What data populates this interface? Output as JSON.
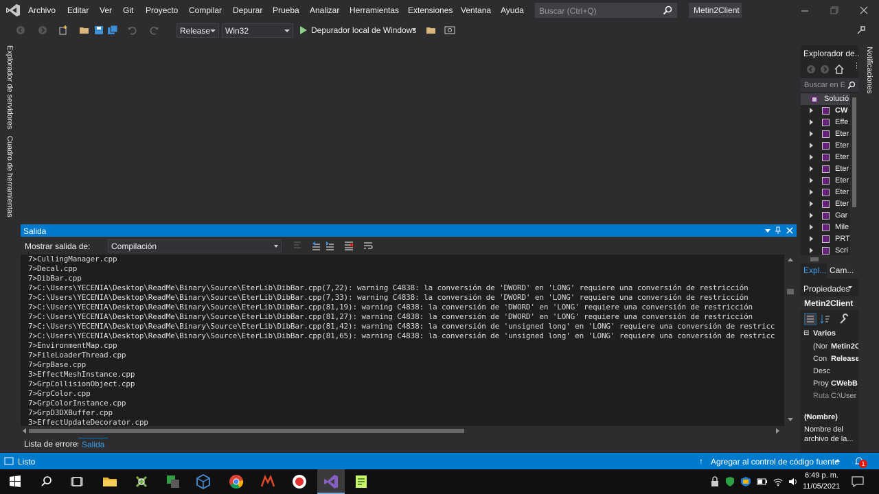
{
  "menubar": {
    "items": [
      "Archivo",
      "Editar",
      "Ver",
      "Git",
      "Proyecto",
      "Compilar",
      "Depurar",
      "Prueba",
      "Analizar",
      "Herramientas",
      "Extensiones",
      "Ventana",
      "Ayuda"
    ],
    "search_placeholder": "Buscar (Ctrl+Q)",
    "solution_name": "Metin2Client"
  },
  "toolbar": {
    "configuration": "Release",
    "platform": "Win32",
    "run_label": "Depurador local de Windows"
  },
  "left_tabs": [
    "Explorador de servidores",
    "Cuadro de herramientas"
  ],
  "right_tab": "Notificaciones",
  "output": {
    "title": "Salida",
    "show_label": "Mostrar salida de:",
    "source": "Compilación",
    "lines": [
      "7>CullingManager.cpp",
      "7>Decal.cpp",
      "7>DibBar.cpp",
      "7>C:\\Users\\YECENIA\\Desktop\\ReadMe\\Binary\\Source\\EterLib\\DibBar.cpp(7,22): warning C4838: la conversión de 'DWORD' en 'LONG' requiere una conversión de restricción",
      "7>C:\\Users\\YECENIA\\Desktop\\ReadMe\\Binary\\Source\\EterLib\\DibBar.cpp(7,33): warning C4838: la conversión de 'DWORD' en 'LONG' requiere una conversión de restricción",
      "7>C:\\Users\\YECENIA\\Desktop\\ReadMe\\Binary\\Source\\EterLib\\DibBar.cpp(81,19): warning C4838: la conversión de 'DWORD' en 'LONG' requiere una conversión de restricción",
      "7>C:\\Users\\YECENIA\\Desktop\\ReadMe\\Binary\\Source\\EterLib\\DibBar.cpp(81,27): warning C4838: la conversión de 'DWORD' en 'LONG' requiere una conversión de restricción",
      "7>C:\\Users\\YECENIA\\Desktop\\ReadMe\\Binary\\Source\\EterLib\\DibBar.cpp(81,42): warning C4838: la conversión de 'unsigned long' en 'LONG' requiere una conversión de restricc",
      "7>C:\\Users\\YECENIA\\Desktop\\ReadMe\\Binary\\Source\\EterLib\\DibBar.cpp(81,65): warning C4838: la conversión de 'unsigned long' en 'LONG' requiere una conversión de restricc",
      "7>EnvironmentMap.cpp",
      "7>FileLoaderThread.cpp",
      "7>GrpBase.cpp",
      "3>EffectMeshInstance.cpp",
      "7>GrpCollisionObject.cpp",
      "7>GrpColor.cpp",
      "7>GrpColorInstance.cpp",
      "7>GrpD3DXBuffer.cpp",
      "3>EffectUpdateDecorator.cpp"
    ]
  },
  "bottom_tabs": [
    "Lista de errores",
    "Salida"
  ],
  "solution_explorer": {
    "title": "Explorador de...",
    "search_placeholder": "Buscar en E",
    "root": "Solució",
    "items": [
      "CW",
      "Effe",
      "Eter",
      "Eter",
      "Eter",
      "Eter",
      "Eter",
      "Eter",
      "Eter",
      "Gar",
      "Mile",
      "PRT",
      "Scri"
    ],
    "tabs": [
      "Expl...",
      "Cam..."
    ]
  },
  "properties": {
    "title": "Propiedades",
    "object": "Metin2Client",
    "category": "Varios",
    "rows": [
      {
        "name": "(Nor",
        "value": "Metin2C"
      },
      {
        "name": "Con",
        "value": "Release"
      },
      {
        "name": "Desc",
        "value": ""
      },
      {
        "name": "Proy",
        "value": "CWebB"
      },
      {
        "name": "Ruta",
        "value": "C:\\User"
      }
    ],
    "desc_title": "(Nombre)",
    "desc_text_1": "Nombre del",
    "desc_text_2": "archivo de la..."
  },
  "statusbar": {
    "status": "Listo",
    "scm": "Agregar al control de código fuente",
    "notification_count": "1"
  },
  "taskbar": {
    "time": "6:49 p. m.",
    "date": "11/05/2021"
  },
  "colors": {
    "accent": "#007acc",
    "vs_purple": "#68217a",
    "background": "#2d2d30"
  }
}
